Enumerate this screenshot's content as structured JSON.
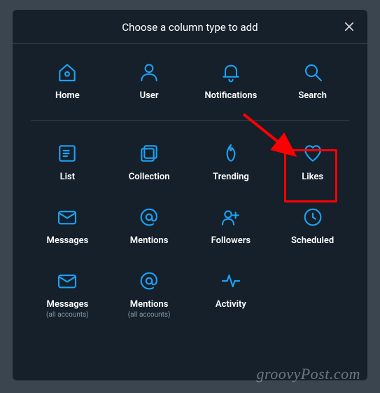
{
  "modal": {
    "title": "Choose a column type to add"
  },
  "row1": {
    "home": "Home",
    "user": "User",
    "notifications": "Notifications",
    "search": "Search"
  },
  "row2": {
    "list": "List",
    "collection": "Collection",
    "trending": "Trending",
    "likes": "Likes"
  },
  "row3": {
    "messages": "Messages",
    "mentions": "Mentions",
    "followers": "Followers",
    "scheduled": "Scheduled"
  },
  "row4": {
    "messagesAll": "Messages",
    "messagesAllSub": "(all accounts)",
    "mentionsAll": "Mentions",
    "mentionsAllSub": "(all accounts)",
    "activity": "Activity"
  },
  "annotation": {
    "highlighted": "likes",
    "color": "#ff0000"
  },
  "watermark": "groovyPost.com"
}
